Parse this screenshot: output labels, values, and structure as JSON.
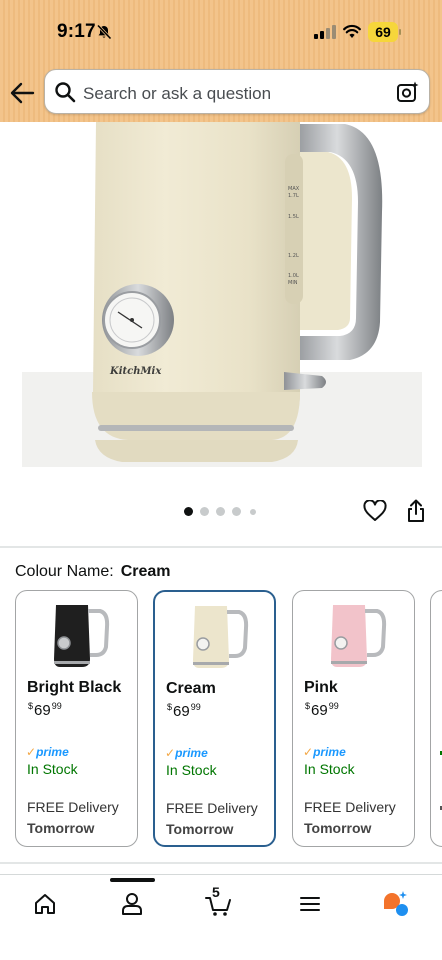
{
  "status_bar": {
    "time": "9:17",
    "battery": "69",
    "icons": [
      "bell-slash-icon",
      "cellular-signal-icon",
      "wifi-icon",
      "battery-icon"
    ]
  },
  "header": {
    "back_icon": "arrow-left-icon",
    "search_placeholder": "Search or ask a question",
    "camera_icon": "camera-lens-icon"
  },
  "product": {
    "image_brand_text": "KitchMix",
    "image_markings": [
      "MAX 1.7L",
      "1.5L",
      "1.2L",
      "1.0L MIN"
    ],
    "carousel": {
      "total": 5,
      "active_index": 0
    },
    "actions": [
      "heart-icon",
      "share-icon"
    ]
  },
  "colour": {
    "label": "Colour Name:",
    "selected": "Cream",
    "options": [
      {
        "name": "Bright Black",
        "price_symbol": "$",
        "price_whole": "69",
        "price_fraction": "99",
        "prime": "prime",
        "stock": "In Stock",
        "delivery": "FREE Delivery",
        "delivery_when": "Tomorrow",
        "swatch": "#1c1c1c"
      },
      {
        "name": "Cream",
        "price_symbol": "$",
        "price_whole": "69",
        "price_fraction": "99",
        "prime": "prime",
        "stock": "In Stock",
        "delivery": "FREE Delivery",
        "delivery_when": "Tomorrow",
        "swatch": "#efe8d2"
      },
      {
        "name": "Pink",
        "price_symbol": "$",
        "price_whole": "69",
        "price_fraction": "99",
        "prime": "prime",
        "stock": "In Stock",
        "delivery": "FREE Delivery",
        "delivery_when": "Tomorrow",
        "swatch": "#f3c5cc"
      }
    ]
  },
  "bottom_nav": {
    "items": [
      "home-icon",
      "account-icon",
      "cart-icon",
      "menu-icon",
      "rufus-assistant-icon"
    ],
    "cart_count": "5"
  },
  "colors": {
    "header_bg": "#f3c48b",
    "selected_border": "#2a5f8f",
    "prime_blue": "#1a98ff",
    "stock_green": "#007600"
  }
}
